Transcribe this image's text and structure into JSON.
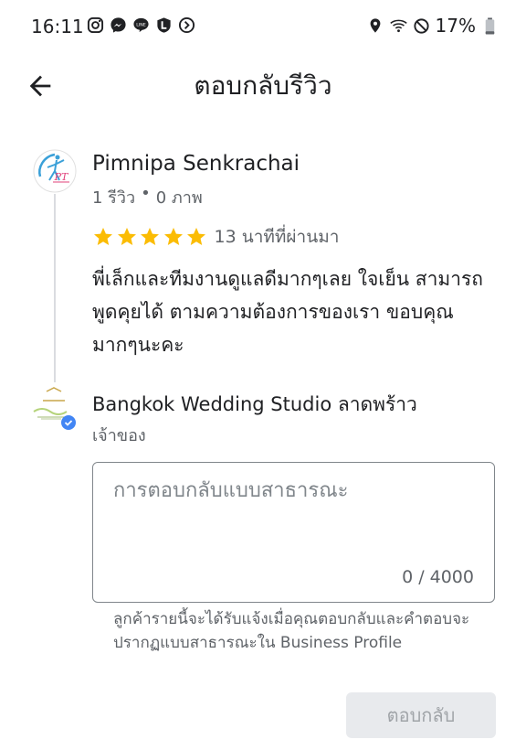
{
  "status_bar": {
    "time": "16:11",
    "battery": "17%",
    "left_icons": [
      "instagram-icon",
      "messenger-icon",
      "line-icon",
      "l-app-icon",
      "arrow-app-icon"
    ],
    "right_icons": [
      "location-icon",
      "wifi-icon",
      "dnd-icon",
      "battery-icon"
    ]
  },
  "app_bar": {
    "title": "ตอบกลับรีวิว",
    "back_icon": "arrow-left-icon"
  },
  "review": {
    "reviewer_name": "Pimnipa Senkrachai",
    "reviews_count": "1 รีวิว",
    "separator": "•",
    "photos_count": "0 ภาพ",
    "rating": 5,
    "max_rating": 5,
    "time_ago": "13 นาทีที่ผ่านมา",
    "text": "พี่เล็กและทีมงานดูแลดีมากๆเลย ใจเย็น สามารถพูดคุยได้ ตามความต้องการของเรา ขอบคุณมากๆนะคะ",
    "avatar_logo_text": "PT"
  },
  "owner": {
    "name": "Bangkok Wedding Studio ลาดพร้าว",
    "role": "เจ้าของ"
  },
  "reply": {
    "placeholder": "การตอบกลับแบบสาธารณะ",
    "value": "",
    "counter": "0 / 4000",
    "helper": "ลูกค้ารายนี้จะได้รับแจ้งเมื่อคุณตอบกลับและคำตอบจะปรากฏแบบสาธารณะใน Business Profile",
    "submit_label": "ตอบกลับ"
  },
  "colors": {
    "star": "#fbbc04",
    "verified_badge": "#4285f4",
    "disabled_button_bg": "#e8eaed",
    "disabled_button_text": "#a0a4a8"
  }
}
